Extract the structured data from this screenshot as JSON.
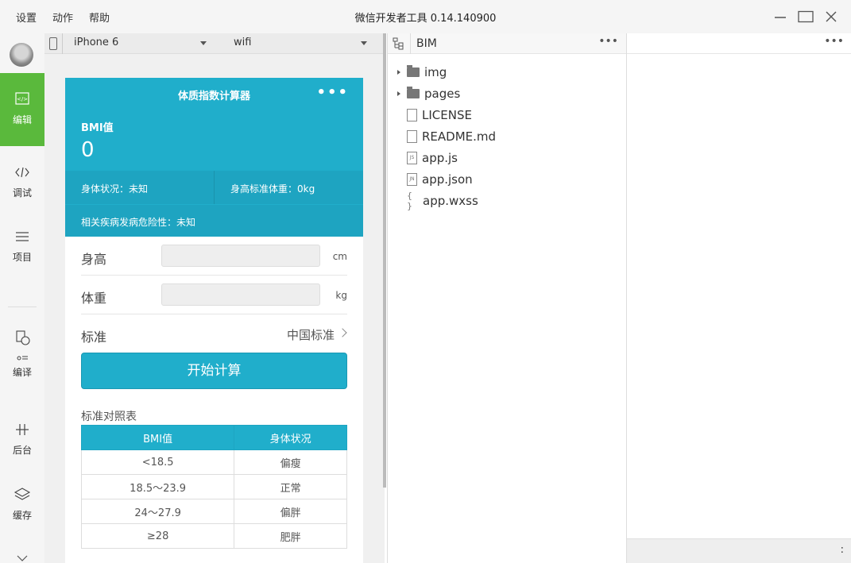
{
  "menu": {
    "settings": "设置",
    "actions": "动作",
    "help": "帮助"
  },
  "window": {
    "title": "微信开发者工具 0.14.140900"
  },
  "sidebar": {
    "items": [
      {
        "label": "编辑",
        "icon": "code-icon"
      },
      {
        "label": "调试",
        "icon": "debug-icon"
      },
      {
        "label": "项目",
        "icon": "list-icon"
      },
      {
        "label": "编译",
        "icon": "compile-icon"
      },
      {
        "label": "后台",
        "icon": "backend-icon"
      },
      {
        "label": "缓存",
        "icon": "layers-icon"
      }
    ]
  },
  "simulator": {
    "device": "iPhone 6",
    "network": "wifi"
  },
  "phone": {
    "title": "体质指数计算器",
    "more": "•••",
    "bmi_label": "BMI值",
    "bmi_value": "0",
    "body_status": "身体状况：未知",
    "standard_weight": "身高标准体重：0kg",
    "disease_risk": "相关疾病发病危险性：未知",
    "height_label": "身高",
    "height_unit": "cm",
    "height_value": "",
    "weight_label": "体重",
    "weight_unit": "kg",
    "weight_value": "",
    "standard_label": "标准",
    "standard_value": "中国标准",
    "calc_button": "开始计算",
    "ref_title": "标准对照表",
    "table": {
      "headers": [
        "BMI值",
        "身体状况"
      ],
      "rows": [
        [
          "<18.5",
          "偏瘦"
        ],
        [
          "18.5～23.9",
          "正常"
        ],
        [
          "24～27.9",
          "偏胖"
        ],
        [
          "≥28",
          "肥胖"
        ]
      ]
    }
  },
  "file_tree": {
    "project": "BIM",
    "more": "•••",
    "items": [
      "img",
      "pages",
      "LICENSE",
      "README.md",
      "app.js",
      "app.json",
      "app.wxss"
    ]
  },
  "right_panel": {
    "more": "•••",
    "footer": ":"
  }
}
